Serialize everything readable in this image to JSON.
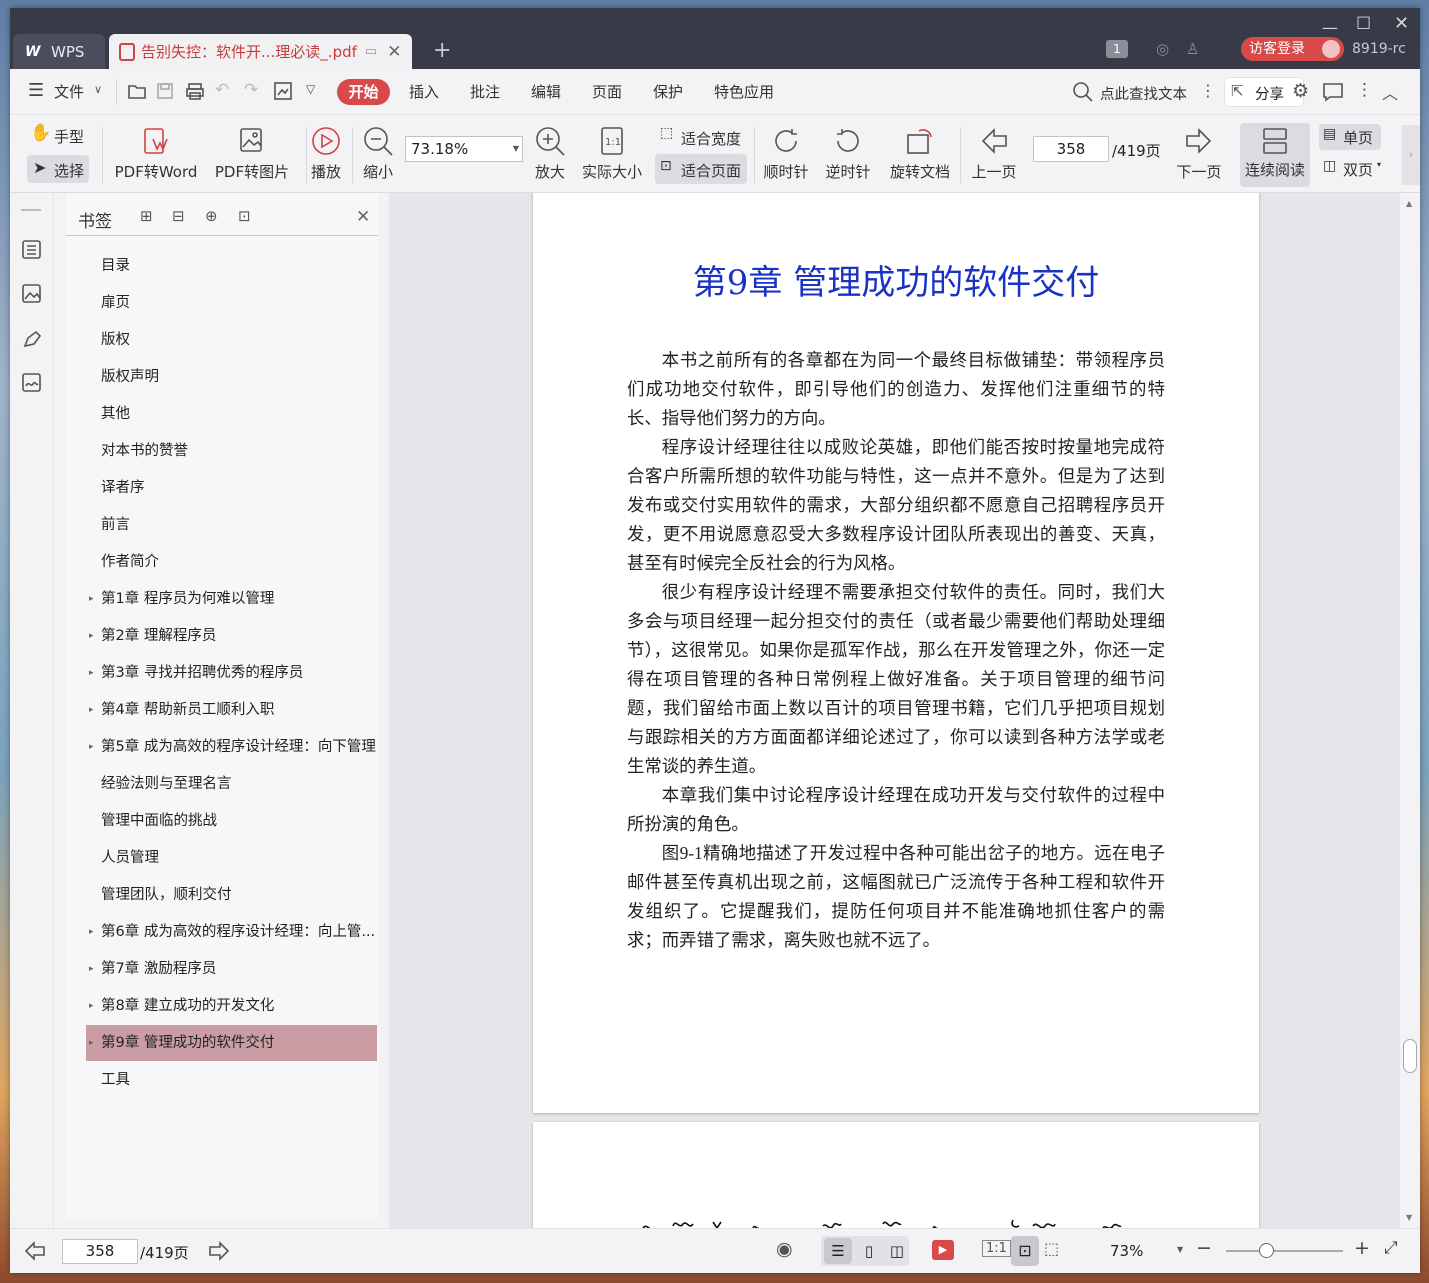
{
  "window": {
    "wps_tab": "WPS",
    "doc_tab": "告别失控：软件开...理必读_.pdf",
    "page_badge": "1",
    "login_label": "访客登录",
    "user_id": "8919-rc"
  },
  "menu": {
    "file": "文件",
    "items": [
      "开始",
      "插入",
      "批注",
      "编辑",
      "页面",
      "保护",
      "特色应用"
    ],
    "search_placeholder": "点此查找文本",
    "share": "分享"
  },
  "toolbar": {
    "hand": "手型",
    "select": "选择",
    "pdf_to_word": "PDF转Word",
    "pdf_to_image": "PDF转图片",
    "play": "播放",
    "zoom_out": "缩小",
    "zoom_value": "73.18%",
    "zoom_in": "放大",
    "actual_size": "实际大小",
    "fit_width": "适合宽度",
    "fit_page": "适合页面",
    "clockwise": "顺时针",
    "counterclockwise": "逆时针",
    "rotate_doc": "旋转文档",
    "prev_page": "上一页",
    "page_current": "358",
    "page_total": "/419页",
    "next_page": "下一页",
    "continuous": "连续阅读",
    "single_page": "单页",
    "double_page": "双页"
  },
  "bookmarks": {
    "title": "书签",
    "items": [
      {
        "label": "目录",
        "expandable": false
      },
      {
        "label": "扉页",
        "expandable": false
      },
      {
        "label": "版权",
        "expandable": false
      },
      {
        "label": "版权声明",
        "expandable": false
      },
      {
        "label": "其他",
        "expandable": false
      },
      {
        "label": "对本书的赞誉",
        "expandable": false
      },
      {
        "label": "译者序",
        "expandable": false
      },
      {
        "label": "前言",
        "expandable": false
      },
      {
        "label": "作者简介",
        "expandable": false
      },
      {
        "label": "第1章 程序员为何难以管理",
        "expandable": true
      },
      {
        "label": "第2章 理解程序员",
        "expandable": true
      },
      {
        "label": "第3章 寻找并招聘优秀的程序员",
        "expandable": true
      },
      {
        "label": "第4章 帮助新员工顺利入职",
        "expandable": true
      },
      {
        "label": "第5章 成为高效的程序设计经理：向下管理",
        "expandable": true
      },
      {
        "label": "经验法则与至理名言",
        "expandable": false
      },
      {
        "label": "管理中面临的挑战",
        "expandable": false
      },
      {
        "label": "人员管理",
        "expandable": false
      },
      {
        "label": "管理团队，顺利交付",
        "expandable": false
      },
      {
        "label": "第6章 成为高效的程序设计经理：向上管...",
        "expandable": true
      },
      {
        "label": "第7章 激励程序员",
        "expandable": true
      },
      {
        "label": "第8章 建立成功的开发文化",
        "expandable": true
      },
      {
        "label": "第9章 管理成功的软件交付",
        "expandable": true,
        "selected": true
      },
      {
        "label": "工具",
        "expandable": false
      }
    ]
  },
  "document": {
    "chapter_title": "第9章 管理成功的软件交付",
    "lines": [
      [
        "本书之前所有的各章都在为同一个最终目标做铺垫：带领程序",
        "员们成功地交付软件，即引导他们的创造力、发挥他们注重细节的",
        "特长、指导他们努力的方向。"
      ],
      [
        "程序设计经理往往以成败论英雄，即他们能否按时按量地完成",
        "符合客户所需所想的软件功能与特性，这一点并不意外。但是为了",
        "达到发布或交付实用软件的需求，大部分组织都不愿意自己招聘程",
        "序员开发，更不用说愿意忍受大多数程序设计团队所表现出的善",
        "变、天真，甚至有时候完全反社会的行为风格。"
      ],
      [
        "很少有程序设计经理不需要承担交付软件的责任。同时，我们",
        "大多会与项目经理一起分担交付的责任（或者最少需要他们帮助处",
        "理细节），这很常见。如果你是孤军作战，那么在开发管理之外，",
        "你还一定得在项目管理的各种日常例程上做好准备。关于项目管理",
        "的细节问题，我们留给市面上数以百计的项目管理书籍，它们几乎",
        "把项目规划与跟踪相关的方方面面都详细论述过了，你可以读到各",
        "种方法学或老生常谈的养生道。"
      ],
      [
        "本章我们集中讨论程序设计经理在成功开发与交付软件的过程",
        "中所扮演的角色。"
      ],
      [
        "图9-1精确地描述了开发过程中各种可能出岔子的地方。远在电",
        "子邮件甚至传真机出现之前，这幅图就已广泛流传于各种工程和软",
        "件开发组织了。它提醒我们，提防任何项目并不能准确地抓住客户",
        "的需求；而弄错了需求，离失败也就不远了。"
      ]
    ]
  },
  "status": {
    "page_current": "358",
    "page_total": "/419页",
    "zoom": "73%"
  }
}
